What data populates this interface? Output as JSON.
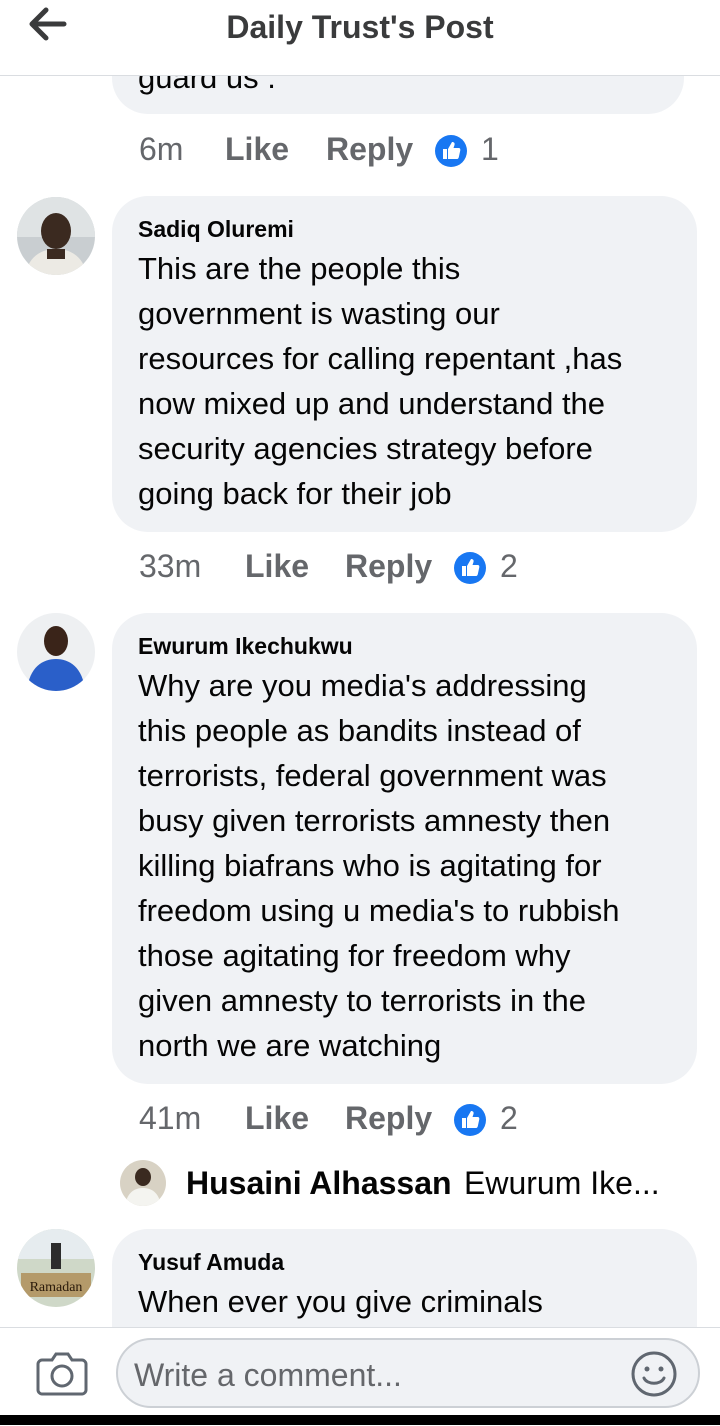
{
  "header": {
    "title": "Daily Trust's Post",
    "back_icon": "back-arrow-icon"
  },
  "partial_comment": {
    "text_tail": "guard us .",
    "time": "6m",
    "like_label": "Like",
    "reply_label": "Reply",
    "reactions": "1"
  },
  "comments": [
    {
      "name": "Sadiq Oluremi",
      "lines": [
        "This are the people this",
        "government is wasting our",
        "resources for calling repentant ,has",
        "now mixed up and understand the",
        "security agencies strategy before",
        "going back for their job"
      ],
      "time": "33m",
      "like_label": "Like",
      "reply_label": "Reply",
      "reactions": "2"
    },
    {
      "name": "Ewurum Ikechukwu",
      "lines": [
        "Why are you media's addressing",
        "this people as bandits instead of",
        "terrorists, federal government was",
        "busy given terrorists amnesty then",
        "killing biafrans who is agitating for",
        "freedom using u media's to rubbish",
        "those agitating for freedom why",
        "given amnesty to terrorists in the",
        "north we are watching"
      ],
      "time": "41m",
      "like_label": "Like",
      "reply_label": "Reply",
      "reactions": "2",
      "reply_preview": {
        "name": "Husaini Alhassan",
        "text": "Ewurum Ike..."
      }
    },
    {
      "name": "Yusuf Amuda",
      "lines": [
        "When ever you give criminals"
      ],
      "avatar_text": "Ramadan"
    }
  ],
  "composer": {
    "placeholder": "Write a comment...",
    "camera_icon": "camera-icon",
    "emoji_icon": "emoji-icon"
  },
  "colors": {
    "bubble": "#f0f2f5",
    "meta": "#65676b",
    "like_blue": "#1877f2"
  }
}
